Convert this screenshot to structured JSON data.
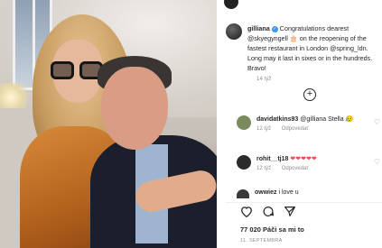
{
  "post": {
    "username": "gilliana",
    "verified_badge": "verified-badge-icon",
    "caption_prefix": "Congratulations dearest @skyegyngell 🎂 on the reopening of the fastest restaurant in London @spring_ldn. Long may it last in sixes or in the hundreds. Bravo!",
    "caption_time": "14 týž"
  },
  "comments": [
    {
      "username": "davidatkins93",
      "text": "@gilliana Stella 😥",
      "time": "12 týž",
      "reply_label": "Odpovedať",
      "avatar_color": "#7b8a5c"
    },
    {
      "username": "rohit__tj18",
      "text": "❤❤❤❤❤",
      "time": "12 týž",
      "reply_label": "Odpovedať",
      "avatar_color": "#2b2b2b"
    },
    {
      "username": "owwiez",
      "text": "i love u",
      "avatar_color": "#3a3a3a"
    }
  ],
  "actions": {
    "like_icon": "heart-icon",
    "comment_icon": "comment-icon",
    "share_icon": "share-icon"
  },
  "likes_text": "77 020 Páči sa mi to",
  "post_date": "11. SEPTEMBRA",
  "colors": {
    "text": "#262626",
    "muted": "#8e8e8e",
    "verified": "#3897f0",
    "heart": "#ed4956"
  }
}
